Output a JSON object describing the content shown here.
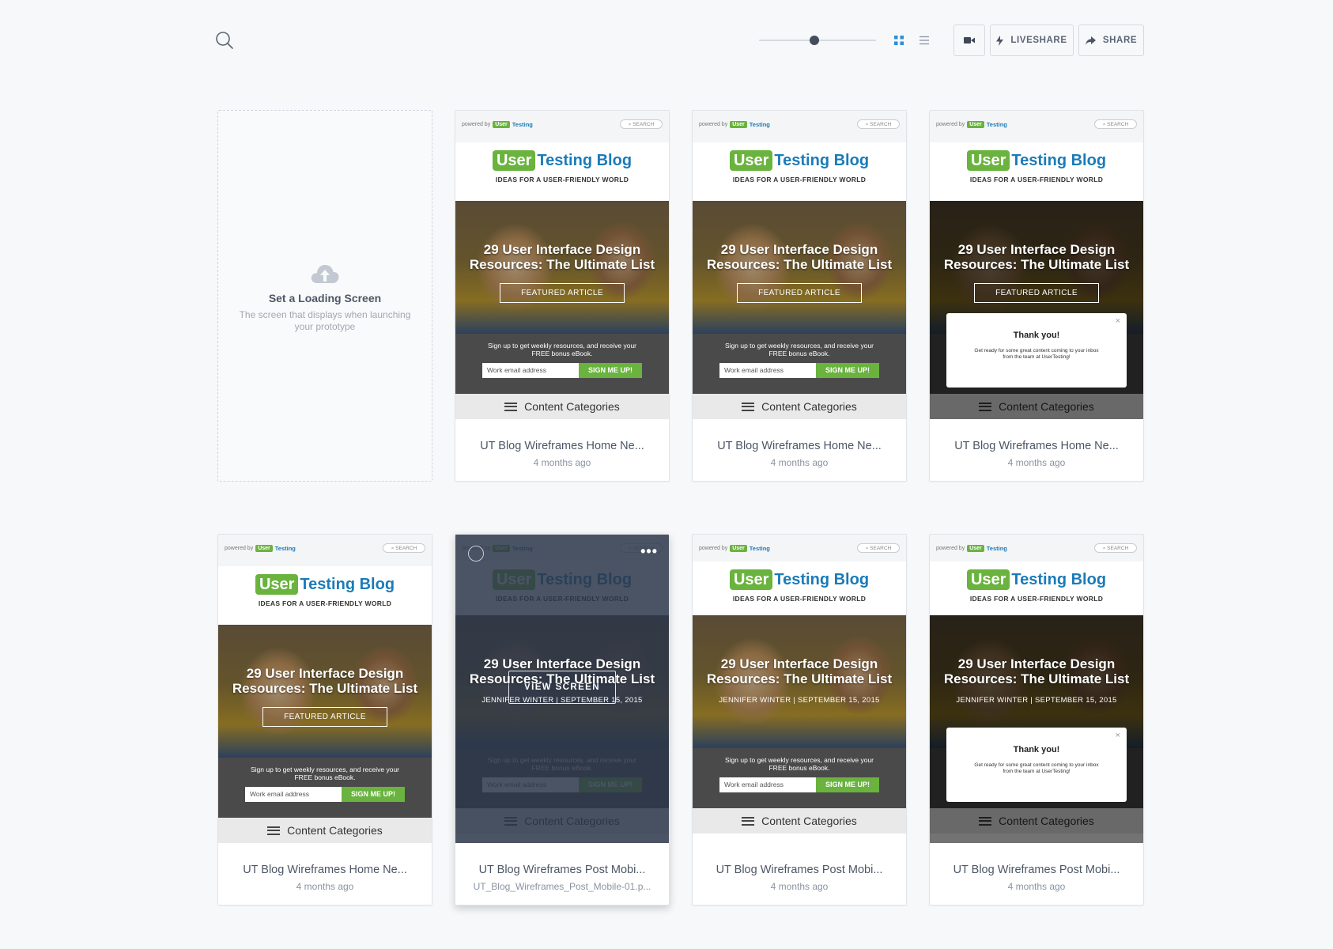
{
  "toolbar": {
    "search_icon": "search-icon",
    "zoom_slider_level": 0.47,
    "grid_view_icon": "grid-view-icon",
    "list_view_icon": "list-view-icon",
    "video_icon": "video-camera-icon",
    "liveshare_label": "LIVESHARE",
    "share_label": "SHARE",
    "accent_color": "#2e8ed6"
  },
  "loading_card": {
    "icon": "cloud-upload-icon",
    "title": "Set a Loading Screen",
    "description": "The screen that displays when launching your prototype"
  },
  "mock": {
    "powered_by": "powered by",
    "ut_badge_user": "User",
    "ut_badge_testing": "Testing",
    "search": "⌕ SEARCH",
    "logo_user": "User",
    "logo_rest": "Testing Blog",
    "tagline": "IDEAS FOR A USER-FRIENDLY WORLD",
    "hero_title": "29 User Interface Design Resources: The Ultimate List",
    "featured": "FEATURED ARTICLE",
    "byline": "JENNIFER WINTER  |  SEPTEMBER 15, 2015",
    "signup_text": "Sign up to get weekly resources, and receive your FREE bonus eBook.",
    "email_placeholder": "Work email address",
    "signup_button": "SIGN ME UP!",
    "categories": "Content Categories",
    "modal_title": "Thank you!",
    "modal_text": "Get ready for some great content coming to your inbox from the team at UserTesting!",
    "modal_close": "×"
  },
  "cards": [
    {
      "name": "UT Blog Wireframes Home Ne...",
      "sub": "4 months ago"
    },
    {
      "name": "UT Blog Wireframes Home Ne...",
      "sub": "4 months ago"
    },
    {
      "name": "UT Blog Wireframes Home Ne...",
      "sub": "4 months ago"
    },
    {
      "name": "UT Blog Wireframes Home Ne...",
      "sub": "4 months ago"
    },
    {
      "name": "UT Blog Wireframes Post Mobi...",
      "sub": "UT_Blog_Wireframes_Post_Mobile-01.p..."
    },
    {
      "name": "UT Blog Wireframes Post Mobi...",
      "sub": "4 months ago"
    },
    {
      "name": "UT Blog Wireframes Post Mobi...",
      "sub": "4 months ago"
    }
  ],
  "hover": {
    "view_screen": "VIEW SCREEN",
    "more": "•••"
  }
}
